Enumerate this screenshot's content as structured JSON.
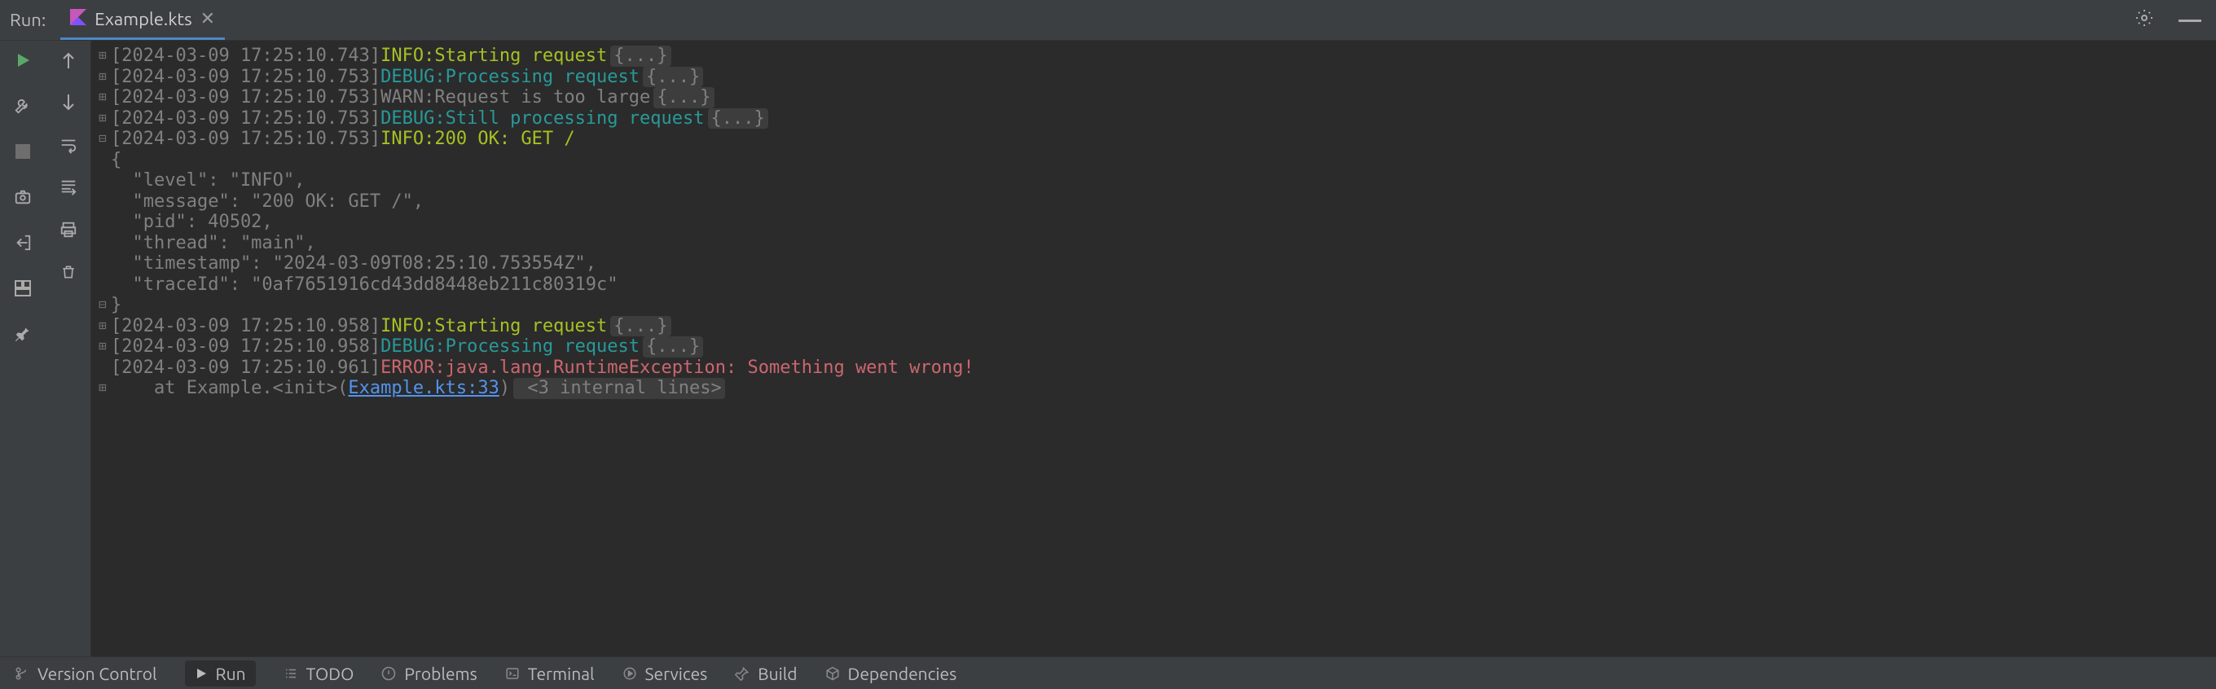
{
  "header": {
    "run_label": "Run:",
    "tab_filename": "Example.kts"
  },
  "console": {
    "lines": [
      {
        "gutter": "⊞",
        "ts": "[2024-03-09 17:25:10.743]",
        "level": "INFO",
        "msg": "Starting request",
        "fold": "{...}"
      },
      {
        "gutter": "⊞",
        "ts": "[2024-03-09 17:25:10.753]",
        "level": "DEBUG",
        "msg": "Processing request",
        "fold": "{...}"
      },
      {
        "gutter": "⊞",
        "ts": "[2024-03-09 17:25:10.753]",
        "level": "WARN",
        "msg": "Request is too large",
        "fold": "{...}"
      },
      {
        "gutter": "⊞",
        "ts": "[2024-03-09 17:25:10.753]",
        "level": "DEBUG",
        "msg": "Still processing request",
        "fold": "{...}"
      },
      {
        "gutter": "⊟",
        "ts": "[2024-03-09 17:25:10.753]",
        "level": "INFO",
        "msg": "200 OK: GET /"
      },
      {
        "raw": "{"
      },
      {
        "raw": "  \"level\": \"INFO\","
      },
      {
        "raw": "  \"message\": \"200 OK: GET /\","
      },
      {
        "raw": "  \"pid\": 40502,"
      },
      {
        "raw": "  \"thread\": \"main\","
      },
      {
        "raw": "  \"timestamp\": \"2024-03-09T08:25:10.753554Z\","
      },
      {
        "raw": "  \"traceId\": \"0af7651916cd43dd8448eb211c80319c\""
      },
      {
        "raw": "}",
        "gutter": "⊟"
      },
      {
        "gutter": "⊞",
        "ts": "[2024-03-09 17:25:10.958]",
        "level": "INFO",
        "msg": "Starting request",
        "fold": "{...}"
      },
      {
        "gutter": "⊞",
        "ts": "[2024-03-09 17:25:10.958]",
        "level": "DEBUG",
        "msg": "Processing request",
        "fold": "{...}"
      },
      {
        "gutter": " ",
        "ts": "[2024-03-09 17:25:10.961]",
        "level": "ERROR",
        "msg": "java.lang.RuntimeException: Something went wrong!"
      },
      {
        "gutter": "⊞",
        "stack_prefix": "    at Example.<init>(",
        "stack_link": "Example.kts:33",
        "stack_suffix": ")",
        "stack_tail": " <3 internal lines>"
      }
    ]
  },
  "bottombar": {
    "items": [
      {
        "label": "Version Control"
      },
      {
        "label": "Run",
        "active": true
      },
      {
        "label": "TODO"
      },
      {
        "label": "Problems"
      },
      {
        "label": "Terminal"
      },
      {
        "label": "Services"
      },
      {
        "label": "Build"
      },
      {
        "label": "Dependencies"
      }
    ]
  }
}
